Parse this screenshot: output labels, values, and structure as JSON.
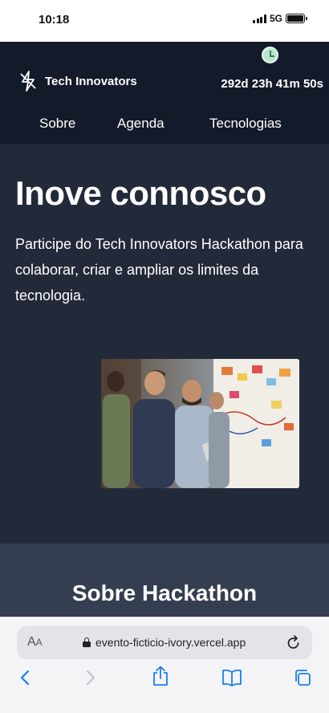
{
  "status_bar": {
    "time": "10:18",
    "network": "5G"
  },
  "header": {
    "brand_name": "Tech Innovators",
    "countdown": "292d 23h 41m 50s",
    "nav": [
      "Sobre",
      "Agenda",
      "Tecnologias"
    ]
  },
  "hero": {
    "title": "Inove connosco",
    "description": "Participe do Tech Innovators Hackathon para colaborar, criar e ampliar os limites da tecnologia.",
    "image_alt": "people-at-whiteboard-photo"
  },
  "about": {
    "title": "Sobre Hackathon"
  },
  "browser": {
    "text_size_label": "AA",
    "url": "evento-ficticio-ivory.vercel.app",
    "accent_color": "#1a7cf5"
  },
  "colors": {
    "header_bg": "#131a2a",
    "hero_bg": "#222a3a",
    "about_bg": "#353e50"
  }
}
